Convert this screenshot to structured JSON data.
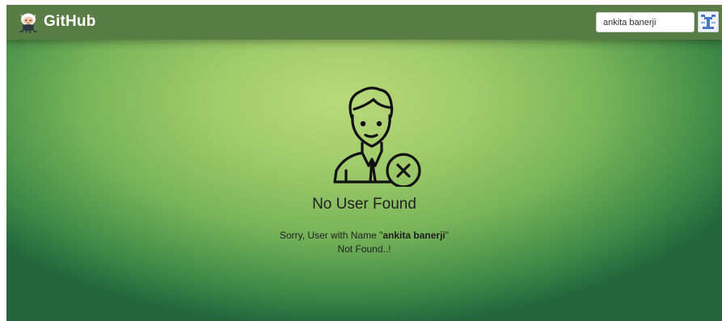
{
  "navbar": {
    "brand": "GitHub",
    "search": {
      "value": "ankita banerji",
      "placeholder": "",
      "button_icon": "search-icon"
    }
  },
  "empty_state": {
    "icon": "user-not-found-icon",
    "heading": "No User Found",
    "message_prefix": "Sorry, User with Name \"",
    "username": "ankita banerji",
    "message_suffix": "\"",
    "message_line2": "Not Found..!"
  },
  "colors": {
    "navbar": "#5a7d46",
    "background_center": "#b9d97a",
    "background_edge": "#23663d",
    "text": "#1f1f1f"
  }
}
